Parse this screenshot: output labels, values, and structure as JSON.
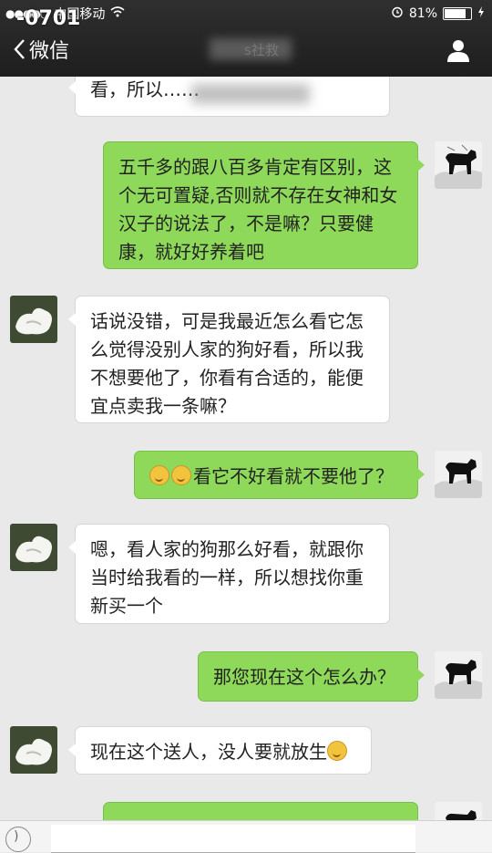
{
  "status_bar": {
    "signal_dots": "●●●●○",
    "carrier": "中国移动",
    "wifi_icon": "wifi-icon",
    "alarm_icon": "alarm-icon",
    "battery_percent": "81%",
    "battery_level": 0.81,
    "overlay_code": "-0701"
  },
  "nav": {
    "back_label": "微信",
    "title_fragment": "s社救"
  },
  "messages": [
    {
      "from": "them",
      "text": "看，所以……"
    },
    {
      "from": "me",
      "text": "五千多的跟八百多肯定有区别，这个无可置疑,否则就不存在女神和女汉子的说法了，不是嘛？只要健康，就好好养着吧"
    },
    {
      "from": "them",
      "text": "话说没错，可是我最近怎么看它怎么觉得没别人家的狗好看，所以我不想要他了，你看有合适的，能便宜点卖我一条嘛？"
    },
    {
      "from": "me",
      "text": "看它不好看就不要他了？",
      "emoji_prefix": 2
    },
    {
      "from": "them",
      "text": "嗯，看人家的狗那么好看，就跟你当时给我看的一样，所以想找你重新买一个"
    },
    {
      "from": "me",
      "text": "那您现在这个怎么办？"
    },
    {
      "from": "them",
      "text": "现在这个送人，没人要就放生",
      "emoji_suffix": 1
    },
    {
      "from": "me",
      "text": ""
    }
  ],
  "colors": {
    "out_bubble": "#8fd95a",
    "in_bubble": "#ffffff",
    "chat_bg": "#e9e9e9",
    "topbar": "#262626"
  }
}
